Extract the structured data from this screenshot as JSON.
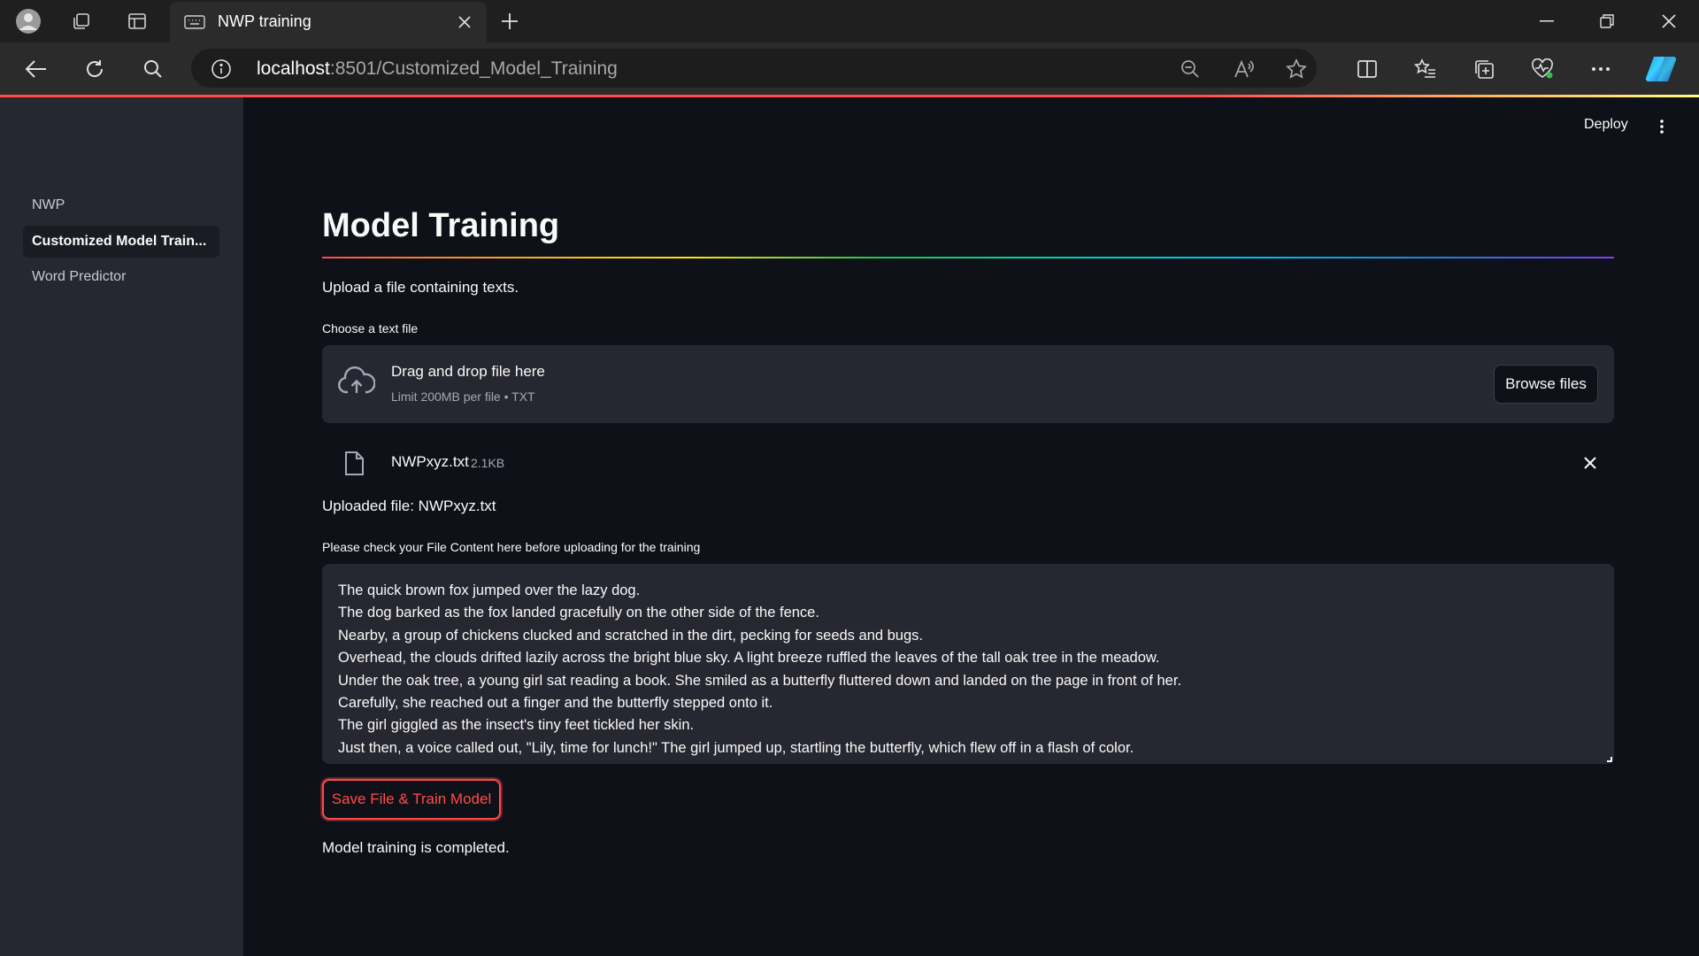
{
  "browser": {
    "tab_title": "NWP training",
    "url_host": "localhost",
    "url_path": ":8501/Customized_Model_Training"
  },
  "app": {
    "deploy_label": "Deploy",
    "sidebar": {
      "items": [
        {
          "label": "NWP",
          "active": false
        },
        {
          "label": "Customized Model Train...",
          "active": true
        },
        {
          "label": "Word Predictor",
          "active": false
        }
      ]
    },
    "main": {
      "title": "Model Training",
      "upload_description": "Upload a file containing texts.",
      "uploader": {
        "label": "Choose a text file",
        "drop_title": "Drag and drop file here",
        "limit_text": "Limit 200MB per file • TXT",
        "browse_label": "Browse files"
      },
      "file": {
        "name": "NWPxyz.txt",
        "size": "2.1KB"
      },
      "uploaded_message": "Uploaded file: NWPxyz.txt",
      "textarea_label": "Please check your File Content here before uploading for the training",
      "textarea_content": "The quick brown fox jumped over the lazy dog.\nThe dog barked as the fox landed gracefully on the other side of the fence.\nNearby, a group of chickens clucked and scratched in the dirt, pecking for seeds and bugs.\nOverhead, the clouds drifted lazily across the bright blue sky. A light breeze ruffled the leaves of the tall oak tree in the meadow.\nUnder the oak tree, a young girl sat reading a book. She smiled as a butterfly fluttered down and landed on the page in front of her.\nCarefully, she reached out a finger and the butterfly stepped onto it.\nThe girl giggled as the insect's tiny feet tickled her skin.\nJust then, a voice called out, \"Lily, time for lunch!\" The girl jumped up, startling the butterfly, which flew off in a flash of color.",
      "train_button_label": "Save File & Train Model",
      "completion_message": "Model training is completed."
    }
  },
  "colors": {
    "accent": "#ff4b4b",
    "background": "#0e1117",
    "sidebar": "#262730"
  }
}
